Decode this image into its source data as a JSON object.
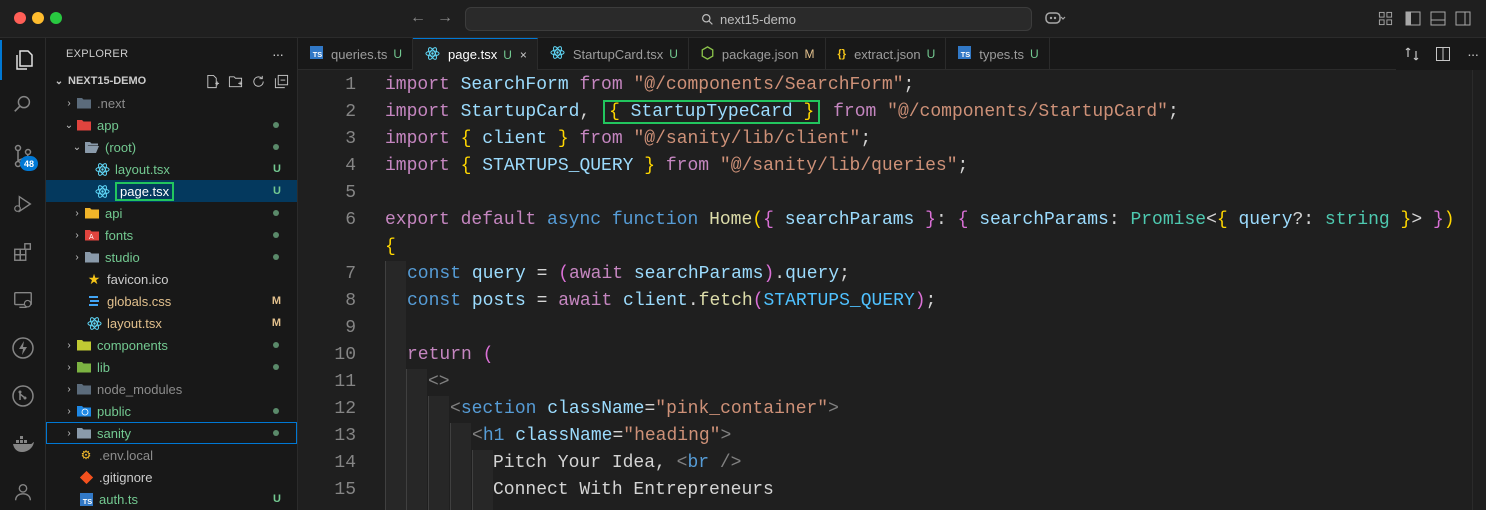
{
  "window": {
    "title": "next15-demo",
    "nav_back": "←",
    "nav_forward": "→",
    "search_icon": "search-icon"
  },
  "activity_bar": {
    "items": [
      "explorer-icon",
      "search-icon",
      "source-control-icon",
      "run-debug-icon",
      "extensions-icon",
      "remote-explorer-icon",
      "thunder-icon",
      "git-graph-icon",
      "docker-icon",
      "accounts-icon"
    ],
    "scm_badge": "48"
  },
  "sidebar": {
    "title": "EXPLORER",
    "more": "···",
    "project": "NEXT15-DEMO",
    "tree": [
      {
        "label": ".next",
        "status": "",
        "dot": false
      },
      {
        "label": "app",
        "status": "",
        "dot": true
      },
      {
        "label": "(root)",
        "status": "",
        "dot": true
      },
      {
        "label": "layout.tsx",
        "status": "U"
      },
      {
        "label": "page.tsx",
        "status": "U"
      },
      {
        "label": "api",
        "status": "",
        "dot": true
      },
      {
        "label": "fonts",
        "status": "",
        "dot": true
      },
      {
        "label": "studio",
        "status": "",
        "dot": true
      },
      {
        "label": "favicon.ico",
        "status": ""
      },
      {
        "label": "globals.css",
        "status": "M"
      },
      {
        "label": "layout.tsx",
        "status": "M"
      },
      {
        "label": "components",
        "status": "",
        "dot": true
      },
      {
        "label": "lib",
        "status": "",
        "dot": true
      },
      {
        "label": "node_modules",
        "status": ""
      },
      {
        "label": "public",
        "status": "",
        "dot": true
      },
      {
        "label": "sanity",
        "status": "",
        "dot": true
      },
      {
        "label": ".env.local",
        "status": ""
      },
      {
        "label": ".gitignore",
        "status": ""
      },
      {
        "label": "auth.ts",
        "status": "U"
      }
    ]
  },
  "tabs": [
    {
      "label": "queries.ts",
      "status": "U"
    },
    {
      "label": "page.tsx",
      "status": "U",
      "close": "×"
    },
    {
      "label": "StartupCard.tsx",
      "status": "U"
    },
    {
      "label": "package.json",
      "status": "M"
    },
    {
      "label": "extract.json",
      "status": "U"
    },
    {
      "label": "types.ts",
      "status": "U"
    }
  ],
  "editor": {
    "line_numbers": [
      "1",
      "2",
      "3",
      "4",
      "5",
      "6",
      "",
      "7",
      "8",
      "9",
      "10",
      "11",
      "12",
      "13",
      "14",
      "15"
    ],
    "code": {
      "l1": {
        "a": "import ",
        "b": "SearchForm",
        "c": " from ",
        "d": "\"@/components/SearchForm\"",
        "e": ";"
      },
      "l2": {
        "a": "import ",
        "b": "StartupCard",
        "c": ", ",
        "d": "{",
        "e": " StartupTypeCard ",
        "f": "}",
        "g": " from ",
        "h": "\"@/components/StartupCard\"",
        "i": ";"
      },
      "l3": {
        "a": "import ",
        "b": "{",
        "c": " client ",
        "d": "}",
        "e": " from ",
        "f": "\"@/sanity/lib/client\"",
        "g": ";"
      },
      "l4": {
        "a": "import ",
        "b": "{",
        "c": " STARTUPS_QUERY ",
        "d": "}",
        "e": " from ",
        "f": "\"@/sanity/lib/queries\"",
        "g": ";"
      },
      "l6": {
        "a": "export ",
        "b": "default ",
        "c": "async ",
        "d": "function ",
        "e": "Home",
        "f": "(",
        "g": "{",
        "h": " searchParams ",
        "i": "}",
        "j": ": ",
        "k": "{",
        "l": " searchParams",
        "m": ": ",
        "n": "Promise",
        "o": "<",
        "p": "{",
        "q": " query",
        "r": "?: ",
        "s": "string",
        "t": " }",
        "u": ">",
        "w": " }",
        "x": ")"
      },
      "l6b": {
        "a": "{"
      },
      "l7": {
        "a": "const ",
        "b": "query",
        "c": " = ",
        "d": "(",
        "e": "await ",
        "f": "searchParams",
        "g": ")",
        "h": ".",
        "i": "query",
        "j": ";"
      },
      "l8": {
        "a": "const ",
        "b": "posts",
        "c": " = ",
        "d": "await ",
        "e": "client",
        "f": ".",
        "g": "fetch",
        "h": "(",
        "i": "STARTUPS_QUERY",
        "j": ")",
        "k": ";"
      },
      "l10": {
        "a": "return ",
        "b": "("
      },
      "l11": {
        "a": "<>"
      },
      "l12": {
        "a": "<",
        "b": "section",
        "c": " className",
        "d": "=",
        "e": "\"pink_container\"",
        "f": ">"
      },
      "l13": {
        "a": "<",
        "b": "h1",
        "c": " className",
        "d": "=",
        "e": "\"heading\"",
        "f": ">"
      },
      "l14": {
        "a": "Pitch Your Idea, ",
        "b": "<",
        "c": "br",
        "d": " />"
      },
      "l15": {
        "a": "Connect With Entrepreneurs"
      }
    }
  }
}
